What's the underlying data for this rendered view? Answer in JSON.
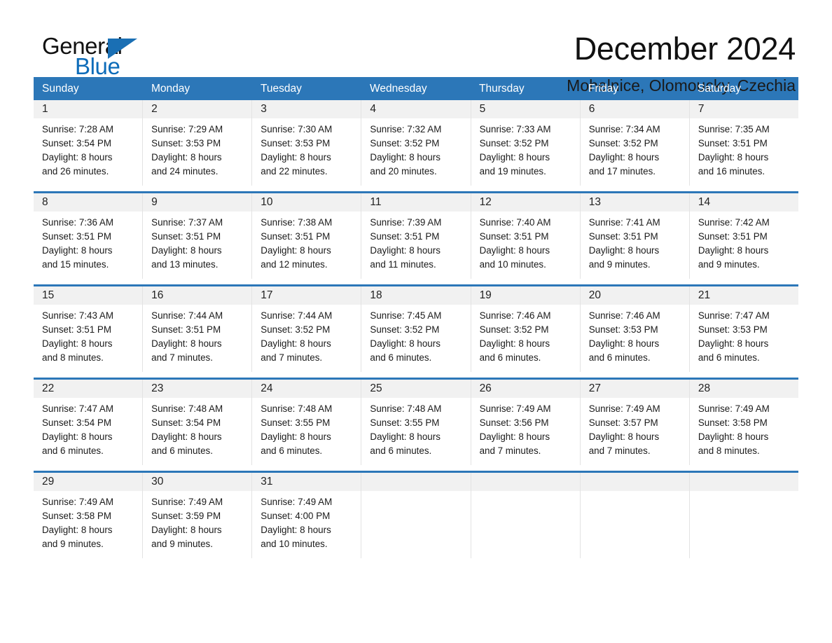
{
  "brand": {
    "name_part1": "General",
    "name_part2": "Blue",
    "triangle_color": "#1a6fb4",
    "blue": "#0d6cb9"
  },
  "header": {
    "month_title": "December 2024",
    "location": "Mohelnice, Olomoucky, Czechia"
  },
  "calendar": {
    "header_color": "#2c77b8",
    "day_band_color": "#f1f1f1",
    "weekdays": [
      "Sunday",
      "Monday",
      "Tuesday",
      "Wednesday",
      "Thursday",
      "Friday",
      "Saturday"
    ],
    "weeks": [
      [
        {
          "day": "1",
          "sunrise": "Sunrise: 7:28 AM",
          "sunset": "Sunset: 3:54 PM",
          "daylight_line1": "Daylight: 8 hours",
          "daylight_line2": "and 26 minutes."
        },
        {
          "day": "2",
          "sunrise": "Sunrise: 7:29 AM",
          "sunset": "Sunset: 3:53 PM",
          "daylight_line1": "Daylight: 8 hours",
          "daylight_line2": "and 24 minutes."
        },
        {
          "day": "3",
          "sunrise": "Sunrise: 7:30 AM",
          "sunset": "Sunset: 3:53 PM",
          "daylight_line1": "Daylight: 8 hours",
          "daylight_line2": "and 22 minutes."
        },
        {
          "day": "4",
          "sunrise": "Sunrise: 7:32 AM",
          "sunset": "Sunset: 3:52 PM",
          "daylight_line1": "Daylight: 8 hours",
          "daylight_line2": "and 20 minutes."
        },
        {
          "day": "5",
          "sunrise": "Sunrise: 7:33 AM",
          "sunset": "Sunset: 3:52 PM",
          "daylight_line1": "Daylight: 8 hours",
          "daylight_line2": "and 19 minutes."
        },
        {
          "day": "6",
          "sunrise": "Sunrise: 7:34 AM",
          "sunset": "Sunset: 3:52 PM",
          "daylight_line1": "Daylight: 8 hours",
          "daylight_line2": "and 17 minutes."
        },
        {
          "day": "7",
          "sunrise": "Sunrise: 7:35 AM",
          "sunset": "Sunset: 3:51 PM",
          "daylight_line1": "Daylight: 8 hours",
          "daylight_line2": "and 16 minutes."
        }
      ],
      [
        {
          "day": "8",
          "sunrise": "Sunrise: 7:36 AM",
          "sunset": "Sunset: 3:51 PM",
          "daylight_line1": "Daylight: 8 hours",
          "daylight_line2": "and 15 minutes."
        },
        {
          "day": "9",
          "sunrise": "Sunrise: 7:37 AM",
          "sunset": "Sunset: 3:51 PM",
          "daylight_line1": "Daylight: 8 hours",
          "daylight_line2": "and 13 minutes."
        },
        {
          "day": "10",
          "sunrise": "Sunrise: 7:38 AM",
          "sunset": "Sunset: 3:51 PM",
          "daylight_line1": "Daylight: 8 hours",
          "daylight_line2": "and 12 minutes."
        },
        {
          "day": "11",
          "sunrise": "Sunrise: 7:39 AM",
          "sunset": "Sunset: 3:51 PM",
          "daylight_line1": "Daylight: 8 hours",
          "daylight_line2": "and 11 minutes."
        },
        {
          "day": "12",
          "sunrise": "Sunrise: 7:40 AM",
          "sunset": "Sunset: 3:51 PM",
          "daylight_line1": "Daylight: 8 hours",
          "daylight_line2": "and 10 minutes."
        },
        {
          "day": "13",
          "sunrise": "Sunrise: 7:41 AM",
          "sunset": "Sunset: 3:51 PM",
          "daylight_line1": "Daylight: 8 hours",
          "daylight_line2": "and 9 minutes."
        },
        {
          "day": "14",
          "sunrise": "Sunrise: 7:42 AM",
          "sunset": "Sunset: 3:51 PM",
          "daylight_line1": "Daylight: 8 hours",
          "daylight_line2": "and 9 minutes."
        }
      ],
      [
        {
          "day": "15",
          "sunrise": "Sunrise: 7:43 AM",
          "sunset": "Sunset: 3:51 PM",
          "daylight_line1": "Daylight: 8 hours",
          "daylight_line2": "and 8 minutes."
        },
        {
          "day": "16",
          "sunrise": "Sunrise: 7:44 AM",
          "sunset": "Sunset: 3:51 PM",
          "daylight_line1": "Daylight: 8 hours",
          "daylight_line2": "and 7 minutes."
        },
        {
          "day": "17",
          "sunrise": "Sunrise: 7:44 AM",
          "sunset": "Sunset: 3:52 PM",
          "daylight_line1": "Daylight: 8 hours",
          "daylight_line2": "and 7 minutes."
        },
        {
          "day": "18",
          "sunrise": "Sunrise: 7:45 AM",
          "sunset": "Sunset: 3:52 PM",
          "daylight_line1": "Daylight: 8 hours",
          "daylight_line2": "and 6 minutes."
        },
        {
          "day": "19",
          "sunrise": "Sunrise: 7:46 AM",
          "sunset": "Sunset: 3:52 PM",
          "daylight_line1": "Daylight: 8 hours",
          "daylight_line2": "and 6 minutes."
        },
        {
          "day": "20",
          "sunrise": "Sunrise: 7:46 AM",
          "sunset": "Sunset: 3:53 PM",
          "daylight_line1": "Daylight: 8 hours",
          "daylight_line2": "and 6 minutes."
        },
        {
          "day": "21",
          "sunrise": "Sunrise: 7:47 AM",
          "sunset": "Sunset: 3:53 PM",
          "daylight_line1": "Daylight: 8 hours",
          "daylight_line2": "and 6 minutes."
        }
      ],
      [
        {
          "day": "22",
          "sunrise": "Sunrise: 7:47 AM",
          "sunset": "Sunset: 3:54 PM",
          "daylight_line1": "Daylight: 8 hours",
          "daylight_line2": "and 6 minutes."
        },
        {
          "day": "23",
          "sunrise": "Sunrise: 7:48 AM",
          "sunset": "Sunset: 3:54 PM",
          "daylight_line1": "Daylight: 8 hours",
          "daylight_line2": "and 6 minutes."
        },
        {
          "day": "24",
          "sunrise": "Sunrise: 7:48 AM",
          "sunset": "Sunset: 3:55 PM",
          "daylight_line1": "Daylight: 8 hours",
          "daylight_line2": "and 6 minutes."
        },
        {
          "day": "25",
          "sunrise": "Sunrise: 7:48 AM",
          "sunset": "Sunset: 3:55 PM",
          "daylight_line1": "Daylight: 8 hours",
          "daylight_line2": "and 6 minutes."
        },
        {
          "day": "26",
          "sunrise": "Sunrise: 7:49 AM",
          "sunset": "Sunset: 3:56 PM",
          "daylight_line1": "Daylight: 8 hours",
          "daylight_line2": "and 7 minutes."
        },
        {
          "day": "27",
          "sunrise": "Sunrise: 7:49 AM",
          "sunset": "Sunset: 3:57 PM",
          "daylight_line1": "Daylight: 8 hours",
          "daylight_line2": "and 7 minutes."
        },
        {
          "day": "28",
          "sunrise": "Sunrise: 7:49 AM",
          "sunset": "Sunset: 3:58 PM",
          "daylight_line1": "Daylight: 8 hours",
          "daylight_line2": "and 8 minutes."
        }
      ],
      [
        {
          "day": "29",
          "sunrise": "Sunrise: 7:49 AM",
          "sunset": "Sunset: 3:58 PM",
          "daylight_line1": "Daylight: 8 hours",
          "daylight_line2": "and 9 minutes."
        },
        {
          "day": "30",
          "sunrise": "Sunrise: 7:49 AM",
          "sunset": "Sunset: 3:59 PM",
          "daylight_line1": "Daylight: 8 hours",
          "daylight_line2": "and 9 minutes."
        },
        {
          "day": "31",
          "sunrise": "Sunrise: 7:49 AM",
          "sunset": "Sunset: 4:00 PM",
          "daylight_line1": "Daylight: 8 hours",
          "daylight_line2": "and 10 minutes."
        },
        {
          "day": "",
          "sunrise": "",
          "sunset": "",
          "daylight_line1": "",
          "daylight_line2": ""
        },
        {
          "day": "",
          "sunrise": "",
          "sunset": "",
          "daylight_line1": "",
          "daylight_line2": ""
        },
        {
          "day": "",
          "sunrise": "",
          "sunset": "",
          "daylight_line1": "",
          "daylight_line2": ""
        },
        {
          "day": "",
          "sunrise": "",
          "sunset": "",
          "daylight_line1": "",
          "daylight_line2": ""
        }
      ]
    ]
  }
}
